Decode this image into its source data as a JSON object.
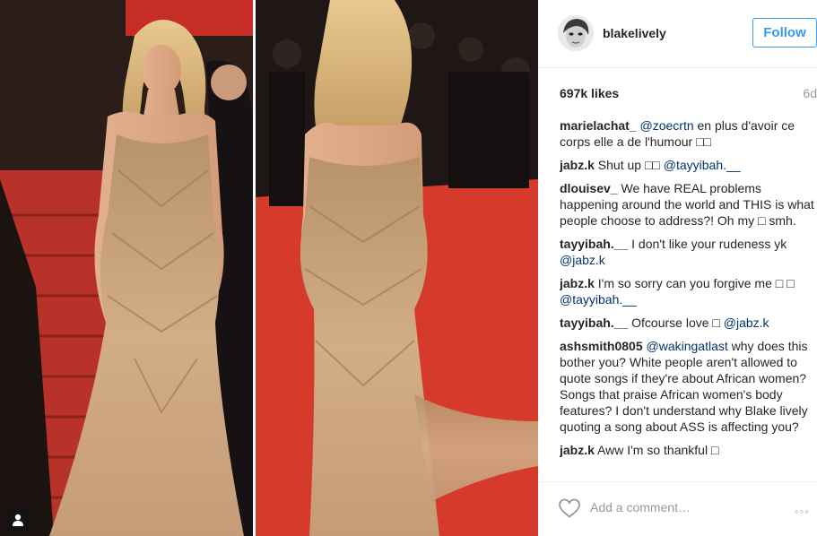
{
  "header": {
    "username": "blakelively",
    "follow_label": "Follow"
  },
  "meta": {
    "likes": "697k likes",
    "age": "6d"
  },
  "comments": [
    {
      "user": "marielachat_",
      "parts": [
        {
          "t": "mention",
          "v": "@zoecrtn"
        },
        {
          "t": "text",
          "v": " en plus d'avoir ce corps elle a de l'humour □□"
        }
      ]
    },
    {
      "user": "jabz.k",
      "parts": [
        {
          "t": "text",
          "v": "Shut up □□ "
        },
        {
          "t": "mention",
          "v": "@tayyibah.__"
        }
      ]
    },
    {
      "user": "dlouisev_",
      "parts": [
        {
          "t": "text",
          "v": "We have REAL problems happening around the world and THIS is what people choose to address?! Oh my □ smh."
        }
      ]
    },
    {
      "user": "tayyibah.__",
      "parts": [
        {
          "t": "text",
          "v": "I don't like your rudeness yk "
        },
        {
          "t": "mention",
          "v": "@jabz.k"
        }
      ]
    },
    {
      "user": "jabz.k",
      "parts": [
        {
          "t": "text",
          "v": "I'm so sorry can you forgive me □ □ "
        },
        {
          "t": "mention",
          "v": "@tayyibah.__"
        }
      ]
    },
    {
      "user": "tayyibah.__",
      "parts": [
        {
          "t": "text",
          "v": "Ofcourse love □ "
        },
        {
          "t": "mention",
          "v": "@jabz.k"
        }
      ]
    },
    {
      "user": "ashsmith0805",
      "parts": [
        {
          "t": "mention",
          "v": "@wakingatlast"
        },
        {
          "t": "text",
          "v": " why does this bother you? White people aren't allowed to quote songs if they're about African women? Songs that praise African women's body features? I don't understand why Blake lively quoting a song about ASS is affecting you?"
        }
      ]
    },
    {
      "user": "jabz.k",
      "parts": [
        {
          "t": "text",
          "v": "Aww I'm so thankful □"
        }
      ]
    }
  ],
  "add_comment": {
    "placeholder": "Add a comment…",
    "more_label": "◦◦◦"
  },
  "icons": {
    "user_tag": "person-tag-icon",
    "like": "heart-outline-icon",
    "more": "more-options-icon"
  },
  "colors": {
    "follow_blue": "#3897f0",
    "mention_blue": "#003569",
    "carpet_red": "#d63a2a",
    "gown_gold": "#c8a07a"
  }
}
